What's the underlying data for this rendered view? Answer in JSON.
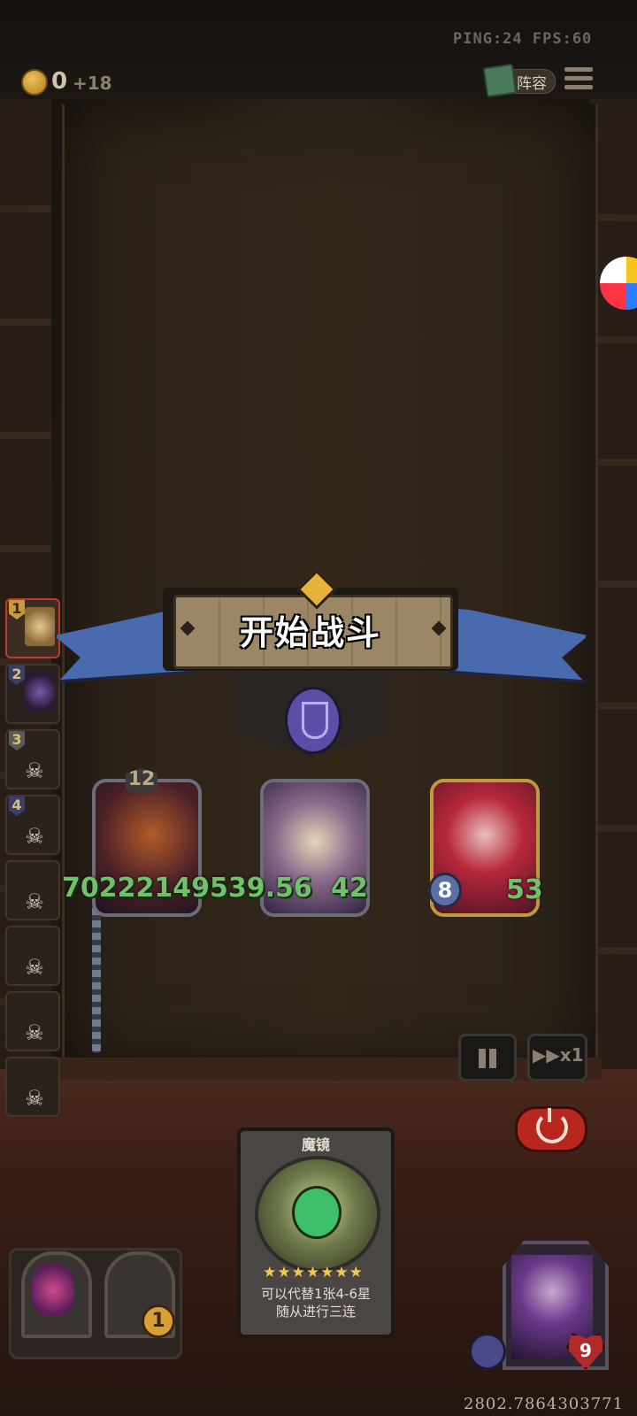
{
  "hud": {
    "ping_fps": "PING:24   FPS:60",
    "gold": "0",
    "gold_income": "+18",
    "lineup_label": "阵容"
  },
  "roster": [
    {
      "rank": "1",
      "active": true
    },
    {
      "rank": "2",
      "active": false
    },
    {
      "rank": "3",
      "active": false,
      "eliminated": true
    },
    {
      "rank": "4",
      "active": false,
      "eliminated": true
    },
    {
      "rank": "",
      "active": false,
      "eliminated": true
    },
    {
      "rank": "",
      "active": false,
      "eliminated": true
    },
    {
      "rank": "",
      "active": false,
      "eliminated": true
    },
    {
      "rank": "",
      "active": false,
      "eliminated": true
    }
  ],
  "banner": {
    "title": "开始战斗"
  },
  "cards": [
    {
      "level": "12",
      "stat_overlay": "70222149539.56"
    },
    {
      "stat_right": "42"
    },
    {
      "attack": "8",
      "health": "53"
    }
  ],
  "controls": {
    "speed_label": "▶▶x1"
  },
  "item_card": {
    "name": "魔镜",
    "stars": "★★★★★★★",
    "description_line1": "可以代替1张4-6星",
    "description_line2": "随从进行三连"
  },
  "shop": {
    "level": "1"
  },
  "hero": {
    "hp": "9"
  },
  "debug_value": "2802.7864303771",
  "colors": {
    "stat_green": "#6fc16a",
    "ribbon_blue": "#4a6ab0",
    "power_red": "#b7271e",
    "gold": "#e6b23b"
  }
}
